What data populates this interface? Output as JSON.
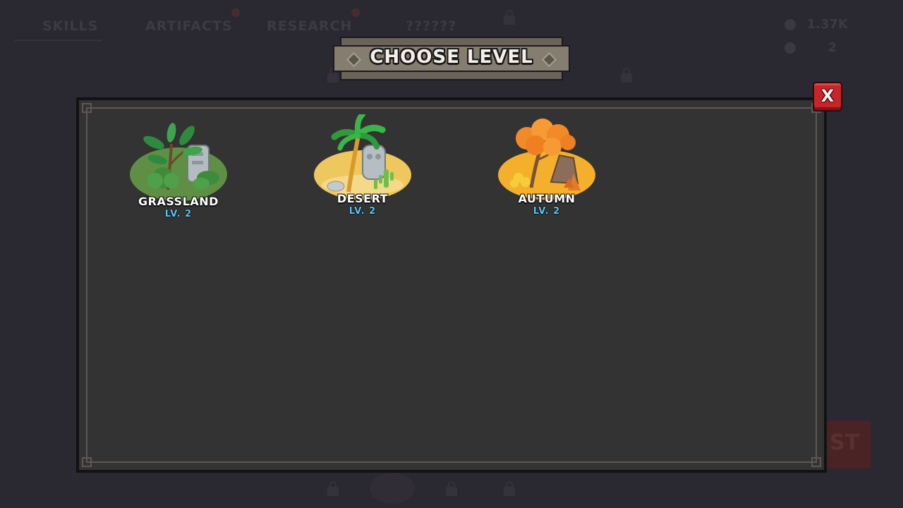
{
  "background": {
    "tabs": [
      "SKILLS",
      "ARTIFACTS",
      "RESEARCH",
      "??????"
    ],
    "stats": [
      "1.37K",
      "2"
    ],
    "corner_button_text": "ST"
  },
  "dialog": {
    "title": "CHOOSE LEVEL",
    "close_label": "X"
  },
  "levels": [
    {
      "name": "GRASSLAND",
      "level": "LV. 2",
      "theme_color": "#5f8f45",
      "icon": "grassland-icon"
    },
    {
      "name": "DESERT",
      "level": "LV. 2",
      "theme_color": "#eec85e",
      "icon": "desert-icon"
    },
    {
      "name": "AUTUMN",
      "level": "LV. 2",
      "theme_color": "#f4b02c",
      "icon": "autumn-icon"
    }
  ],
  "colors": {
    "panel": "#333333",
    "close_button": "#c8242a",
    "level_text": "#59c3f2"
  }
}
